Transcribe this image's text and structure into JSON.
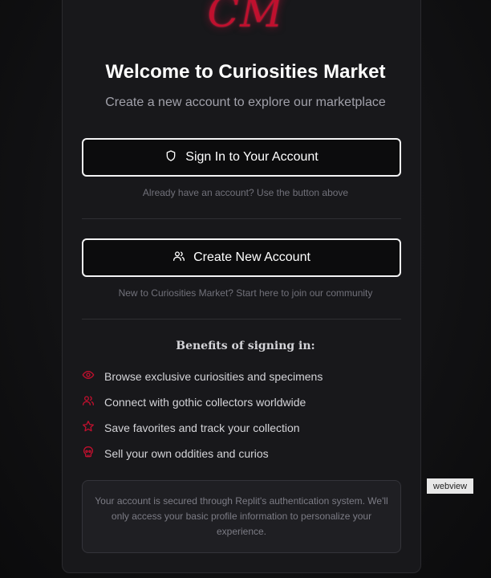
{
  "brand": {
    "logo_text": "CM",
    "accent_color": "#c0102e"
  },
  "header": {
    "title": "Welcome to Curiosities Market",
    "subtitle": "Create a new account to explore our marketplace"
  },
  "signin": {
    "label": "Sign In to Your Account",
    "icon": "shield-icon",
    "hint": "Already have an account? Use the button above"
  },
  "create": {
    "label": "Create New Account",
    "icon": "users-icon",
    "hint": "New to Curiosities Market? Start here to join our community"
  },
  "benefits": {
    "title": "Benefits of signing in:",
    "items": [
      {
        "icon": "eye-icon",
        "label": "Browse exclusive curiosities and specimens"
      },
      {
        "icon": "users-icon",
        "label": "Connect with gothic collectors worldwide"
      },
      {
        "icon": "star-icon",
        "label": "Save favorites and track your collection"
      },
      {
        "icon": "skull-icon",
        "label": "Sell your own oddities and curios"
      }
    ]
  },
  "notice": {
    "text": "Your account is secured through Replit's authentication system. We'll only access your basic profile information to personalize your experience."
  },
  "overlay": {
    "webview_label": "webview"
  }
}
